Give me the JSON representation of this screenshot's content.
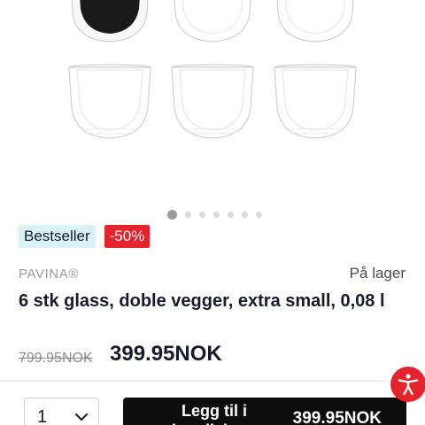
{
  "product": {
    "badges": [
      "Bestseller",
      "-50%"
    ],
    "brand": "PAVINA®",
    "stock_status": "På lager",
    "title": "6 stk glass, doble vegger, extra small, 0,08 l",
    "old_price": "799.95NOK",
    "price": "399.95NOK"
  },
  "gallery": {
    "image_count": 7,
    "active_index": 0,
    "glasses_visible": 6
  },
  "purchase": {
    "quantity": "1",
    "add_to_cart_label": "Legg til i handlekurv",
    "add_to_cart_price": "399.95NOK"
  },
  "icons": {
    "quantity_dropdown": "chevron-down-icon",
    "accessibility": "accessibility-icon"
  },
  "colors": {
    "accent_red": "#e5232d",
    "bestseller_bg": "#d9f2f5",
    "button_black": "#0d0d0d",
    "text_dark": "#1a1a2e"
  }
}
